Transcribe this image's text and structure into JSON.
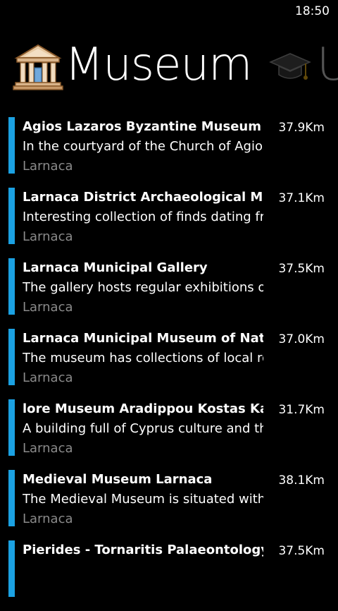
{
  "status": {
    "time": "18:50"
  },
  "pivot": {
    "active_title": "Museum",
    "next_title": "U"
  },
  "items": [
    {
      "name": "Agios Lazaros Byzantine Museum",
      "description": "In the courtyard of the Church of Agios Lazaros",
      "city": "Larnaca",
      "distance": "37.9Km"
    },
    {
      "name": "Larnaca District Archaeological Museum",
      "description": "Interesting collection of finds dating from",
      "city": "Larnaca",
      "distance": "37.1Km"
    },
    {
      "name": "Larnaca Municipal Gallery",
      "description": "The gallery hosts regular exhibitions of",
      "city": "Larnaca",
      "distance": "37.5Km"
    },
    {
      "name": "Larnaca Municipal Museum of Natural History",
      "description": "The museum has collections of local reptiles",
      "city": "Larnaca",
      "distance": "37.0Km"
    },
    {
      "name": "lore Museum Aradippou Kostas Kaimakliotis",
      "description": "A building full of Cyprus culture and the",
      "city": "Larnaca",
      "distance": "31.7Km"
    },
    {
      "name": "Medieval Museum Larnaca",
      "description": "The Medieval Museum is situated within",
      "city": "Larnaca",
      "distance": "38.1Km"
    },
    {
      "name": "Pierides - Tornaritis Palaeontology Museum",
      "description": "",
      "city": "",
      "distance": "37.5Km"
    }
  ]
}
